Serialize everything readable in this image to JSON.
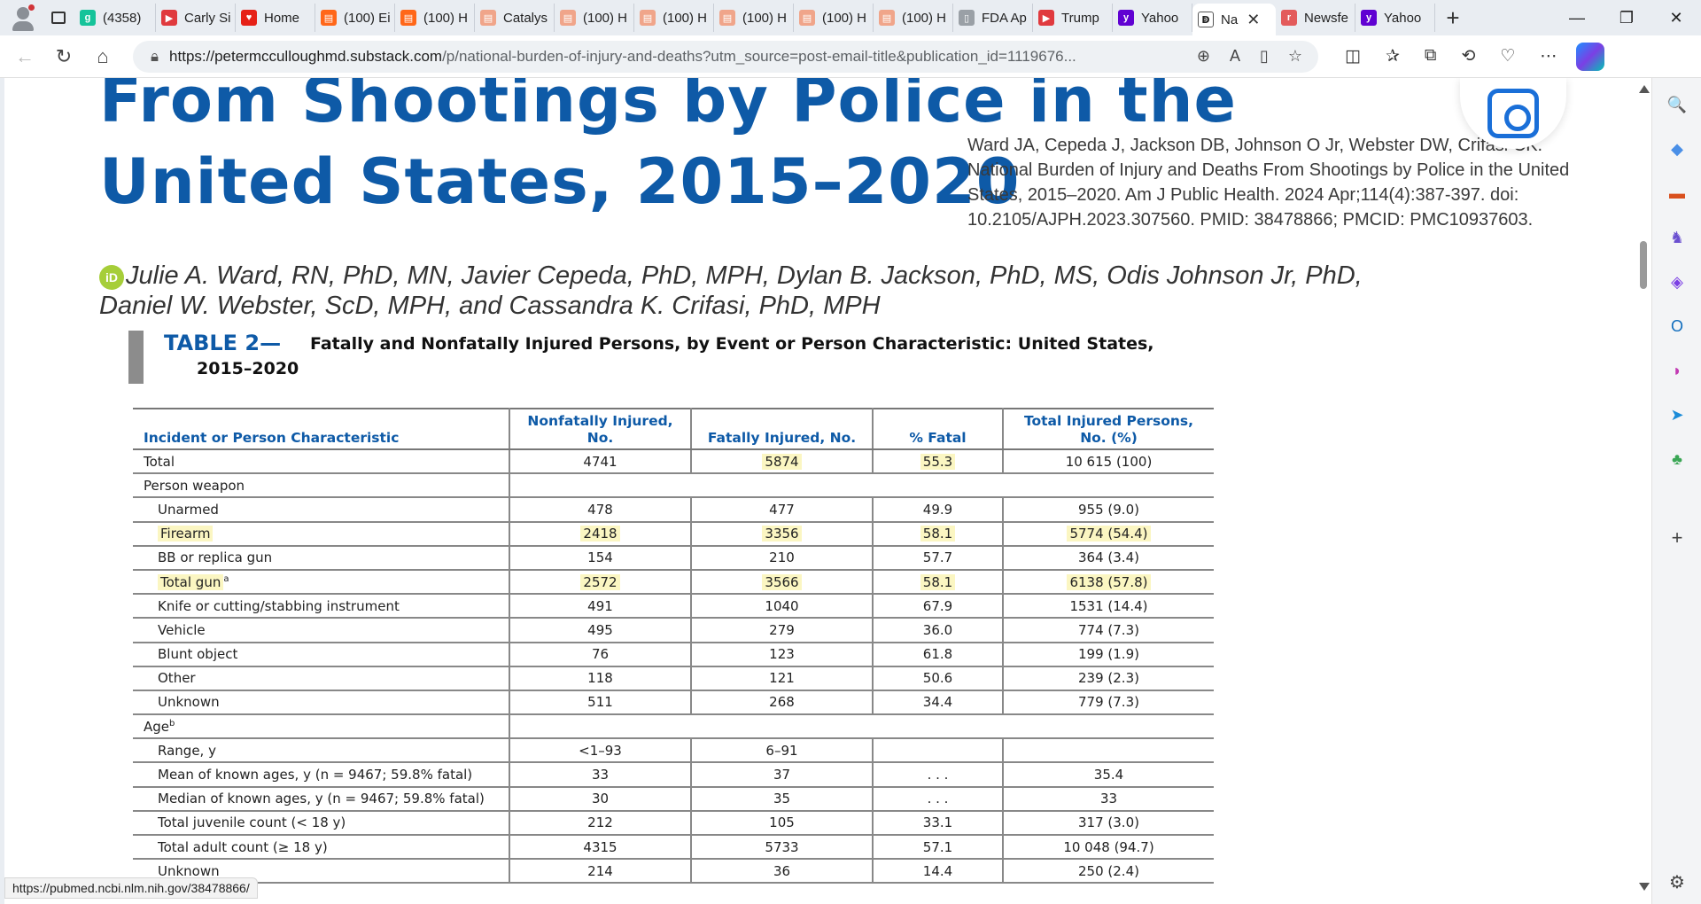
{
  "browser": {
    "tabs": [
      {
        "label": "(4358)",
        "color": "#15c39a",
        "glyph": "g"
      },
      {
        "label": "Carly Si",
        "color": "#e03a3e",
        "glyph": "▶"
      },
      {
        "label": "Home",
        "color": "#e62117",
        "glyph": "♥"
      },
      {
        "label": "(100) Ei",
        "color": "#ff6719",
        "glyph": "▤"
      },
      {
        "label": "(100) H",
        "color": "#ff6719",
        "glyph": "▤"
      },
      {
        "label": "Catalys",
        "color": "#f0a58a",
        "glyph": "▤"
      },
      {
        "label": "(100) H",
        "color": "#f0a58a",
        "glyph": "▤"
      },
      {
        "label": "(100) H",
        "color": "#f0a58a",
        "glyph": "▤"
      },
      {
        "label": "(100) H",
        "color": "#f0a58a",
        "glyph": "▤"
      },
      {
        "label": "(100) H",
        "color": "#f0a58a",
        "glyph": "▤"
      },
      {
        "label": "(100) H",
        "color": "#f0a58a",
        "glyph": "▤"
      },
      {
        "label": "FDA Ap",
        "color": "#9aa0a6",
        "glyph": "▯"
      },
      {
        "label": "Trump",
        "color": "#e03a3e",
        "glyph": "▶"
      },
      {
        "label": "Yahoo",
        "color": "#6001d2",
        "glyph": "y"
      },
      {
        "label": "Na",
        "color": "#ffffff",
        "glyph": "ↁ",
        "active": true
      },
      {
        "label": "Newsfe",
        "color": "#e35b5b",
        "glyph": "r"
      },
      {
        "label": "Yahoo",
        "color": "#6001d2",
        "glyph": "y"
      }
    ],
    "url_host": "https://petermcculloughmd.substack.com",
    "url_path": "/p/national-burden-of-injury-and-deaths?utm_source=post-email-title&publication_id=1119676...",
    "status_url": "https://pubmed.ncbi.nlm.nih.gov/38478866/"
  },
  "article": {
    "title_line1": "From Shootings by Police in the",
    "title_line2": "United States, 2015–2020",
    "citation": "Ward JA, Cepeda J, Jackson DB, Johnson O Jr, Webster DW, Crifasi CK. National Burden of Injury and Deaths From Shootings by Police in the United States, 2015–2020. Am J Public Health. 2024 Apr;114(4):387-397. doi: 10.2105/AJPH.2023.307560. PMID: 38478866; PMCID: PMC10937603.",
    "orcid_badge": "iD",
    "authors_line1": "Julie A. Ward, RN, PhD, MN, Javier Cepeda, PhD, MPH, Dylan B. Jackson, PhD, MS, Odis Johnson Jr, PhD,",
    "authors_line2": "Daniel W. Webster, ScD, MPH, and Cassandra K. Crifasi, PhD, MPH"
  },
  "table": {
    "label": "TABLE 2—",
    "caption": "Fatally and Nonfatally Injured Persons, by Event or Person Characteristic: United States,",
    "caption2": "2015–2020",
    "headers": [
      "Incident or Person Characteristic",
      "Nonfatally Injured, No.",
      "Fatally Injured, No.",
      "% Fatal",
      "Total Injured Persons, No. (%)"
    ],
    "rows": [
      {
        "label": "Total",
        "sup": "",
        "indent": false,
        "hl": false,
        "values": [
          "4741",
          "5874",
          "55.3",
          "10 615 (100)"
        ],
        "hl_cols": [
          1,
          2
        ]
      },
      {
        "label": "Person weapon",
        "section": true
      },
      {
        "label": "Unarmed",
        "sup": "",
        "indent": true,
        "hl": false,
        "values": [
          "478",
          "477",
          "49.9",
          "955 (9.0)"
        ],
        "hl_cols": []
      },
      {
        "label": "Firearm",
        "sup": "",
        "indent": true,
        "hl": true,
        "values": [
          "2418",
          "3356",
          "58.1",
          "5774 (54.4)"
        ],
        "hl_cols": [
          0,
          1,
          2,
          3
        ]
      },
      {
        "label": "BB or replica gun",
        "sup": "",
        "indent": true,
        "hl": false,
        "values": [
          "154",
          "210",
          "57.7",
          "364 (3.4)"
        ],
        "hl_cols": []
      },
      {
        "label": "Total gun",
        "sup": "a",
        "indent": true,
        "hl": true,
        "values": [
          "2572",
          "3566",
          "58.1",
          "6138 (57.8)"
        ],
        "hl_cols": [
          0,
          1,
          2,
          3
        ]
      },
      {
        "label": "Knife or cutting/stabbing instrument",
        "sup": "",
        "indent": true,
        "hl": false,
        "values": [
          "491",
          "1040",
          "67.9",
          "1531 (14.4)"
        ],
        "hl_cols": []
      },
      {
        "label": "Vehicle",
        "sup": "",
        "indent": true,
        "hl": false,
        "values": [
          "495",
          "279",
          "36.0",
          "774 (7.3)"
        ],
        "hl_cols": []
      },
      {
        "label": "Blunt object",
        "sup": "",
        "indent": true,
        "hl": false,
        "values": [
          "76",
          "123",
          "61.8",
          "199 (1.9)"
        ],
        "hl_cols": []
      },
      {
        "label": "Other",
        "sup": "",
        "indent": true,
        "hl": false,
        "values": [
          "118",
          "121",
          "50.6",
          "239 (2.3)"
        ],
        "hl_cols": []
      },
      {
        "label": "Unknown",
        "sup": "",
        "indent": true,
        "hl": false,
        "values": [
          "511",
          "268",
          "34.4",
          "779 (7.3)"
        ],
        "hl_cols": []
      },
      {
        "label": "Age",
        "sup": "b",
        "section": true
      },
      {
        "label": "Range, y",
        "sup": "",
        "indent": true,
        "hl": false,
        "values": [
          "<1–93",
          "6–91",
          "",
          ""
        ],
        "hl_cols": []
      },
      {
        "label": "Mean of known ages, y (n = 9467; 59.8% fatal)",
        "sup": "",
        "indent": true,
        "hl": false,
        "values": [
          "33",
          "37",
          ". . .",
          "35.4"
        ],
        "hl_cols": []
      },
      {
        "label": "Median of known ages, y (n = 9467; 59.8% fatal)",
        "sup": "",
        "indent": true,
        "hl": false,
        "values": [
          "30",
          "35",
          ". . .",
          "33"
        ],
        "hl_cols": []
      },
      {
        "label": "Total juvenile count (< 18 y)",
        "sup": "",
        "indent": true,
        "hl": false,
        "values": [
          "212",
          "105",
          "33.1",
          "317 (3.0)"
        ],
        "hl_cols": []
      },
      {
        "label": "Total adult count (≥ 18 y)",
        "sup": "",
        "indent": true,
        "hl": false,
        "values": [
          "4315",
          "5733",
          "57.1",
          "10 048 (94.7)"
        ],
        "hl_cols": []
      },
      {
        "label": "Unknown",
        "sup": "",
        "indent": true,
        "hl": false,
        "values": [
          "214",
          "36",
          "14.4",
          "250 (2.4)"
        ],
        "hl_cols": []
      }
    ]
  },
  "sidebar_icons": [
    {
      "name": "search-icon",
      "glyph": "🔍",
      "color": "#444"
    },
    {
      "name": "tag-icon",
      "glyph": "◆",
      "color": "#4a8fe7"
    },
    {
      "name": "toolbox-icon",
      "glyph": "▬",
      "color": "#d9501e"
    },
    {
      "name": "games-icon",
      "glyph": "♞",
      "color": "#6a4fd0"
    },
    {
      "name": "copilot-app-icon",
      "glyph": "◈",
      "color": "#7b3fe4"
    },
    {
      "name": "outlook-icon",
      "glyph": "O",
      "color": "#0f6cbd"
    },
    {
      "name": "designer-icon",
      "glyph": "◗",
      "color": "#c239b3"
    },
    {
      "name": "send-icon",
      "glyph": "➤",
      "color": "#1a8bd8"
    },
    {
      "name": "tree-icon",
      "glyph": "♣",
      "color": "#3aa655"
    }
  ]
}
